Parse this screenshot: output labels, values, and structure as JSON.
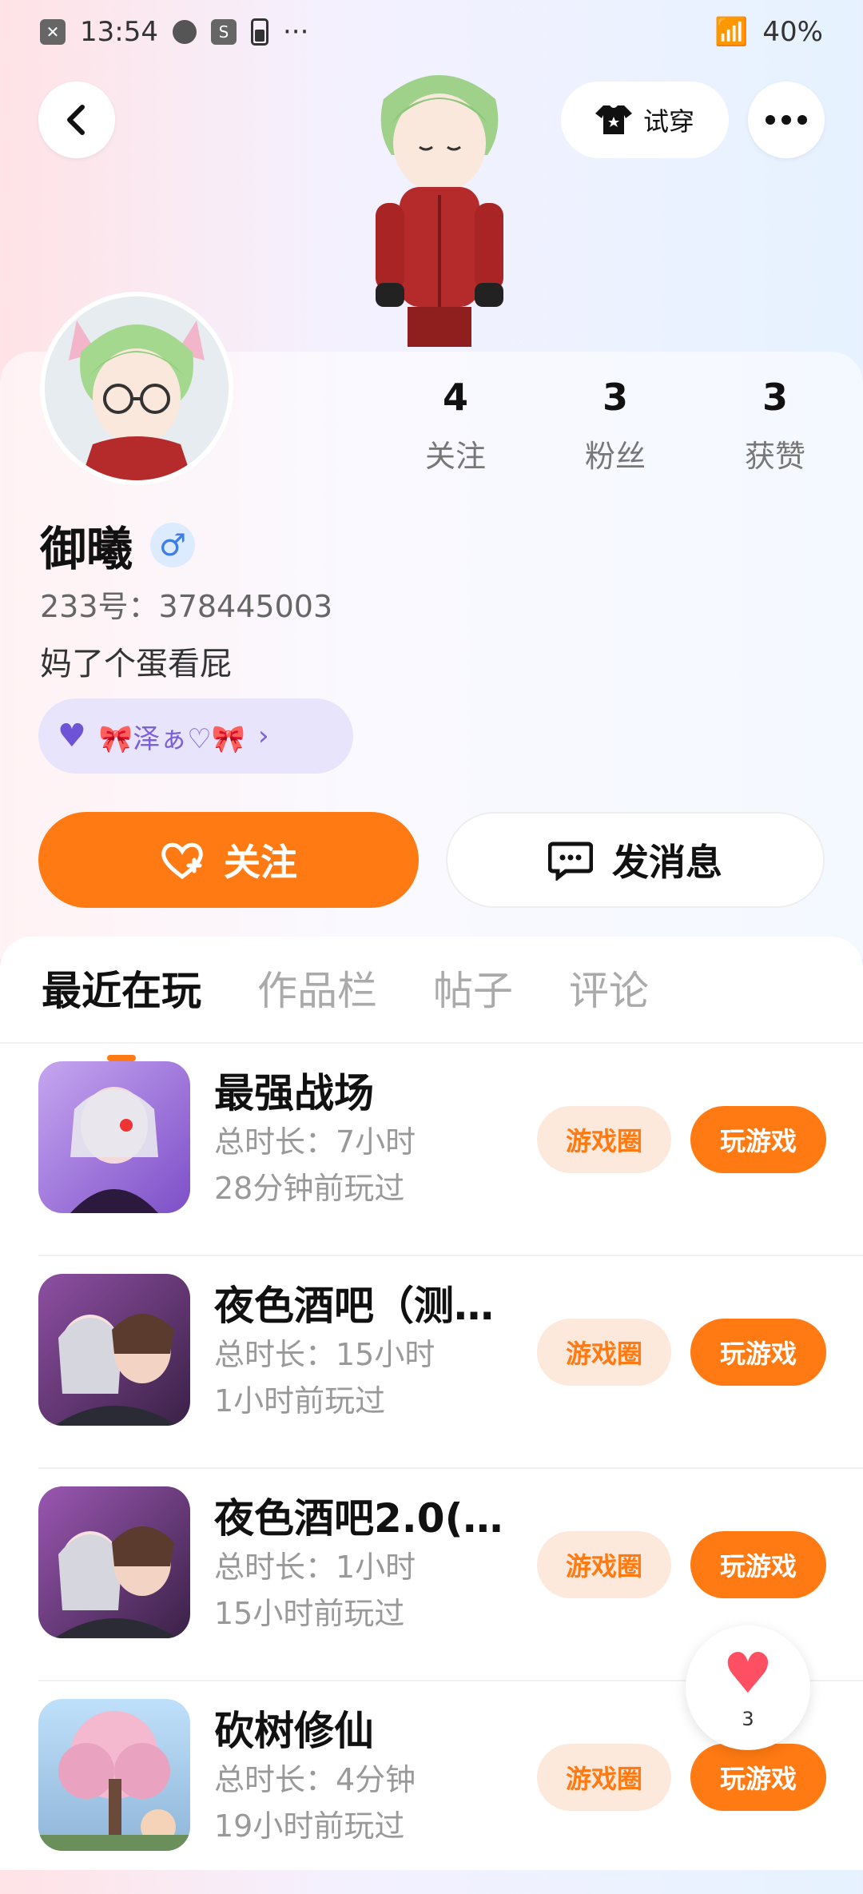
{
  "status": {
    "time": "13:54",
    "battery": "40%"
  },
  "header": {
    "try_on_label": "试穿"
  },
  "profile": {
    "name": "御曦",
    "gender_symbol": "♂",
    "uid": "233号：378445003",
    "bio": "妈了个蛋看屁",
    "cp_label": "🎀泽ぁ♡🎀",
    "stats": [
      {
        "num": "4",
        "label": "关注"
      },
      {
        "num": "3",
        "label": "粉丝"
      },
      {
        "num": "3",
        "label": "获赞"
      }
    ],
    "follow_label": "关注",
    "message_label": "发消息"
  },
  "tabs": [
    "最近在玩",
    "作品栏",
    "帖子",
    "评论"
  ],
  "games": [
    {
      "title": "最强战场",
      "duration": "总时长：7小时",
      "last": "28分钟前玩过",
      "circle": "游戏圈",
      "play": "玩游戏",
      "thumb": "#a07ad8"
    },
    {
      "title": "夜色酒吧（测…",
      "duration": "总时长：15小时",
      "last": "1小时前玩过",
      "circle": "游戏圈",
      "play": "玩游戏",
      "thumb": "#6a3f7a"
    },
    {
      "title": "夜色酒吧2.0(…",
      "duration": "总时长：1小时",
      "last": "15小时前玩过",
      "circle": "游戏圈",
      "play": "玩游戏",
      "thumb": "#6a3f7a"
    },
    {
      "title": "砍树修仙",
      "duration": "总时长：4分钟",
      "last": "19小时前玩过",
      "circle": "游戏圈",
      "play": "玩游戏",
      "thumb": "#9ecbf0"
    }
  ],
  "like_count": "3"
}
